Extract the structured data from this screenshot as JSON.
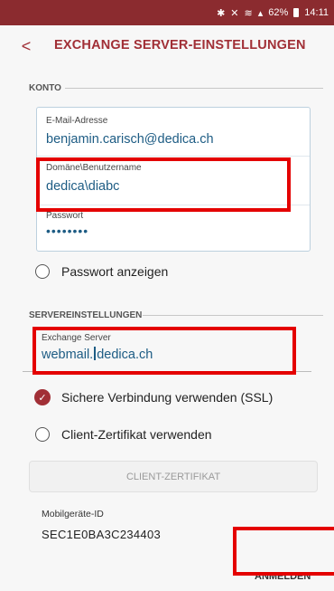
{
  "statusbar": {
    "battery_percent": "62%",
    "time": "14:11",
    "icons": [
      "bluetooth-icon",
      "mute-icon",
      "wifi-icon",
      "signal-icon",
      "battery-icon"
    ]
  },
  "header": {
    "title": "EXCHANGE SERVER-EINSTELLUNGEN",
    "back_symbol": "<"
  },
  "account": {
    "section_label": "KONTO",
    "email_label": "E-Mail-Adresse",
    "email_value": "benjamin.carisch@dedica.ch",
    "domain_user_label": "Domäne\\Benutzername",
    "domain_user_value": "dedica\\diabc",
    "password_label": "Passwort",
    "password_value": "••••••••",
    "show_password_label": "Passwort anzeigen"
  },
  "server": {
    "section_label": "SERVEREINSTELLUNGEN",
    "exchange_server_label": "Exchange Server",
    "exchange_server_value_before_cursor": "webmail.",
    "exchange_server_value_after_cursor": "dedica.ch",
    "ssl_label": "Sichere Verbindung verwenden (SSL)",
    "ssl_checked": true,
    "client_cert_label": "Client-Zertifikat verwenden",
    "client_cert_checked": false,
    "client_cert_button": "CLIENT-ZERTIFIKAT"
  },
  "device": {
    "mobile_id_label": "Mobilgeräte-ID",
    "mobile_id_value": "SEC1E0BA3C234403"
  },
  "footer": {
    "signin_button": "ANMELDEN"
  },
  "colors": {
    "accent": "#a12f36",
    "statusbar": "#8b2b2f",
    "value_text": "#1d5c84",
    "highlight_box": "#e40000"
  }
}
